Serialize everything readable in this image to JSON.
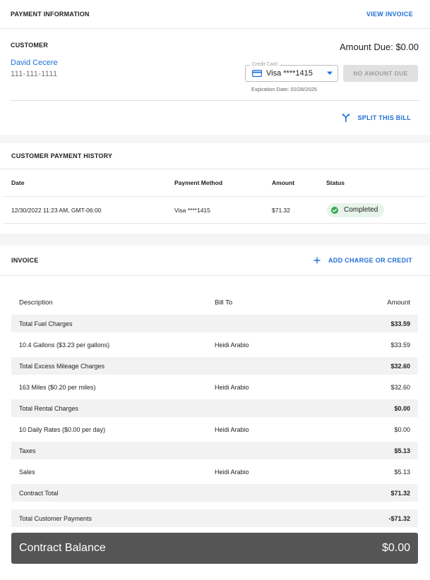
{
  "payment_info": {
    "title": "PAYMENT INFORMATION",
    "view_invoice": "VIEW INVOICE",
    "customer_label": "CUSTOMER",
    "customer_name": "David Cecere",
    "customer_phone": "111-111-1111",
    "amount_due": "Amount Due: $0.00",
    "credit_card_label": "Credit Card",
    "credit_card_value": "Visa ****1415",
    "expiration": "Expiration Date: 02/28/2025",
    "no_amount_due": "NO AMOUNT DUE",
    "split_bill": "SPLIT THIS BILL"
  },
  "history": {
    "title": "CUSTOMER PAYMENT HISTORY",
    "columns": [
      "Date",
      "Payment Method",
      "Amount",
      "Status"
    ],
    "rows": [
      {
        "date": "12/30/2022 11:23 AM, GMT-06:00",
        "method": "Visa ****1415",
        "amount": "$71.32",
        "status": "Completed"
      }
    ]
  },
  "invoice": {
    "title": "INVOICE",
    "add_charge": "ADD CHARGE OR CREDIT",
    "columns": {
      "description": "Description",
      "bill_to": "Bill To",
      "amount": "Amount"
    },
    "rows": [
      {
        "type": "group",
        "description": "Total Fuel Charges",
        "bill_to": "",
        "amount": "$33.59"
      },
      {
        "type": "item",
        "description": "10.4 Gallons ($3.23 per gallons)",
        "bill_to": "Heidi Arabio",
        "amount": "$33.59"
      },
      {
        "type": "group",
        "description": "Total Excess Mileage Charges",
        "bill_to": "",
        "amount": "$32.60"
      },
      {
        "type": "item",
        "description": "163 Miles ($0.20 per miles)",
        "bill_to": "Heidi Arabio",
        "amount": "$32.60"
      },
      {
        "type": "group",
        "description": "Total Rental Charges",
        "bill_to": "",
        "amount": "$0.00"
      },
      {
        "type": "item",
        "description": "10 Daily Rates ($0.00 per day)",
        "bill_to": "Heidi Arabio",
        "amount": "$0.00"
      },
      {
        "type": "group",
        "description": "Taxes",
        "bill_to": "",
        "amount": "$5.13"
      },
      {
        "type": "item",
        "description": "Sales",
        "bill_to": "Heidi Arabio",
        "amount": "$5.13"
      },
      {
        "type": "group",
        "description": "Contract Total",
        "bill_to": "",
        "amount": "$71.32"
      },
      {
        "type": "group",
        "description": "Total Customer Payments",
        "bill_to": "",
        "amount": "-$71.32"
      }
    ],
    "balance_label": "Contract Balance",
    "balance_value": "$0.00"
  },
  "icons": {
    "credit_card": "credit-card-icon",
    "caret": "caret-down-icon",
    "split": "split-icon",
    "check": "check-circle-icon",
    "plus": "plus-icon"
  },
  "colors": {
    "accent": "#1f6fd6",
    "success_bg": "#e6f4ea",
    "success_icon": "#34a853",
    "balance_bg": "#555555"
  }
}
